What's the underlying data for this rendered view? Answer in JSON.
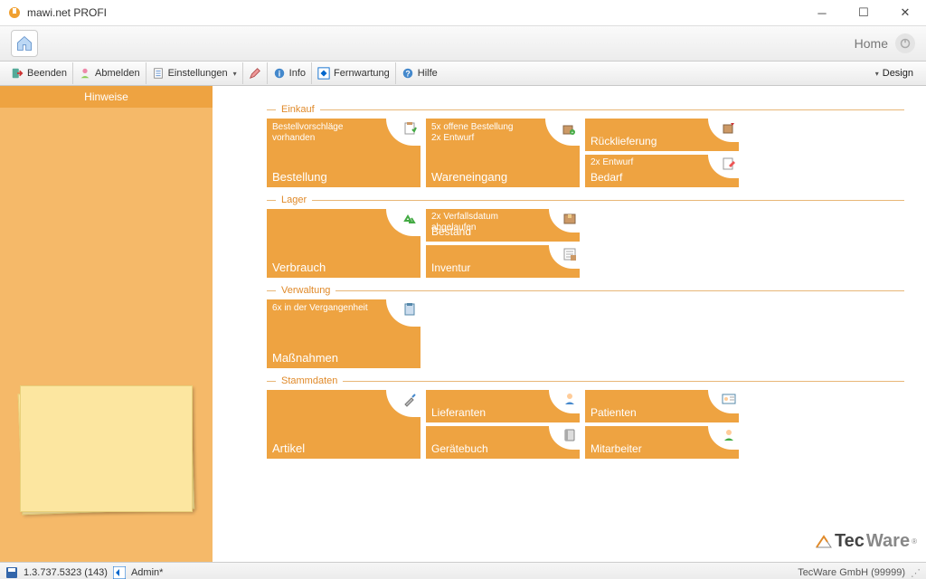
{
  "window": {
    "title": "mawi.net PROFI"
  },
  "banner": {
    "home_label": "Home"
  },
  "toolbar": {
    "beenden": "Beenden",
    "abmelden": "Abmelden",
    "einstellungen": "Einstellungen",
    "info": "Info",
    "fernwartung": "Fernwartung",
    "hilfe": "Hilfe",
    "design": "Design"
  },
  "sidebar": {
    "title": "Hinweise"
  },
  "sections": {
    "einkauf": {
      "label": "Einkauf",
      "bestellung": {
        "title": "Bestellung",
        "note": "Bestellvorschläge vorhanden"
      },
      "wareneingang": {
        "title": "Wareneingang",
        "note1": "5x offene Bestellung",
        "note2": "2x Entwurf"
      },
      "ruecklieferung": {
        "title": "Rücklieferung"
      },
      "bedarf": {
        "title": "Bedarf",
        "note": "2x Entwurf"
      }
    },
    "lager": {
      "label": "Lager",
      "verbrauch": {
        "title": "Verbrauch"
      },
      "bestand": {
        "title": "Bestand",
        "note": "2x Verfallsdatum abgelaufen"
      },
      "inventur": {
        "title": "Inventur"
      }
    },
    "verwaltung": {
      "label": "Verwaltung",
      "massnahmen": {
        "title": "Maßnahmen",
        "note": "6x in der Vergangenheit"
      }
    },
    "stammdaten": {
      "label": "Stammdaten",
      "artikel": {
        "title": "Artikel"
      },
      "lieferanten": {
        "title": "Lieferanten"
      },
      "patienten": {
        "title": "Patienten"
      },
      "geraetebuch": {
        "title": "Gerätebuch"
      },
      "mitarbeiter": {
        "title": "Mitarbeiter"
      }
    }
  },
  "branding": {
    "tec": "Tec",
    "ware": "Ware"
  },
  "status": {
    "version": "1.3.737.5323 (143)",
    "user": "Admin*",
    "right": "TecWare GmbH (99999)"
  }
}
